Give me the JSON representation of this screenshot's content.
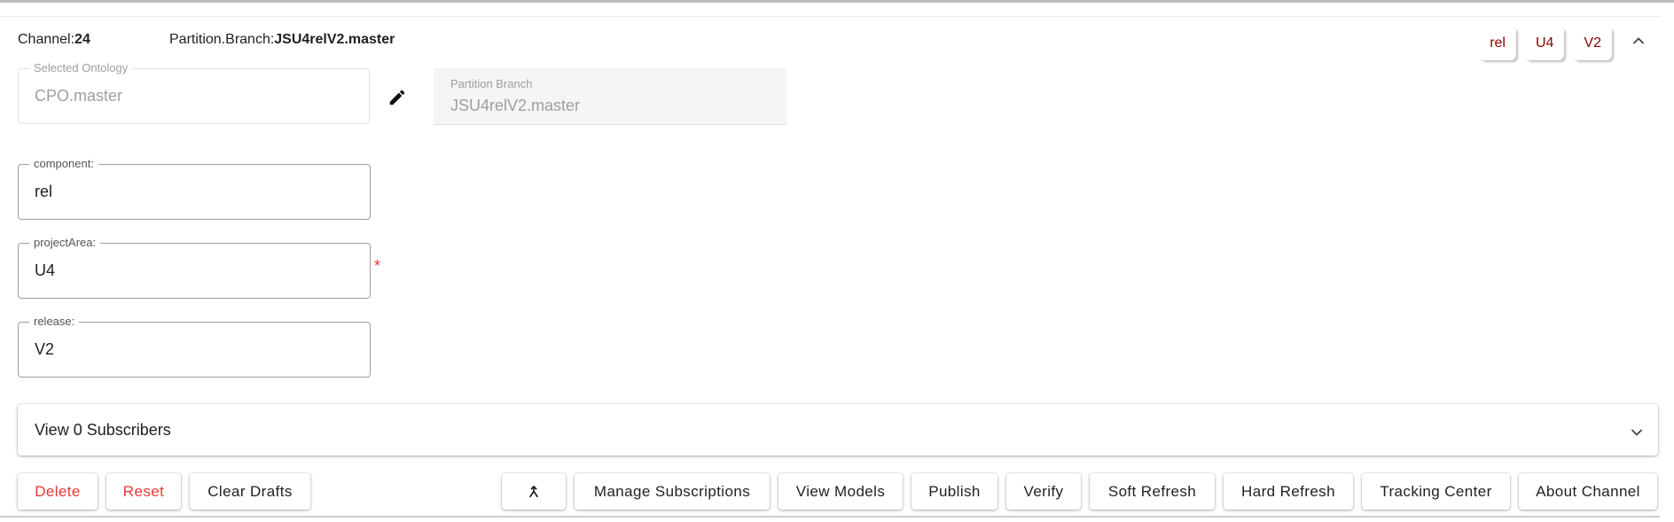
{
  "header": {
    "channel_label": "Channel:",
    "channel_value": "24",
    "partition_label": "Partition.Branch:",
    "partition_value": "JSU4relV2.master"
  },
  "chips": [
    "rel",
    "U4",
    "V2"
  ],
  "ontology": {
    "legend": "Selected Ontology",
    "value": "CPO.master"
  },
  "partition_branch": {
    "label": "Partition Branch",
    "value": "JSU4relV2.master"
  },
  "fields": {
    "component": {
      "legend": "component:",
      "value": "rel"
    },
    "projectArea": {
      "legend": "projectArea:",
      "value": "U4",
      "required": "*"
    },
    "release": {
      "legend": "release:",
      "value": "V2"
    }
  },
  "subscribers": {
    "title": "View 0 Subscribers"
  },
  "buttons": {
    "delete": "Delete",
    "reset": "Reset",
    "clear_drafts": "Clear Drafts",
    "manage_subscriptions": "Manage Subscriptions",
    "view_models": "View Models",
    "publish": "Publish",
    "verify": "Verify",
    "soft_refresh": "Soft Refresh",
    "hard_refresh": "Hard Refresh",
    "tracking_center": "Tracking Center",
    "about_channel": "About Channel"
  },
  "colors": {
    "chip_text": "#8b0000",
    "danger": "#e53935",
    "disabled_text": "#9e9e9e"
  },
  "icons": {
    "edit": "pencil-icon",
    "expand": "chevron-up-icon",
    "collapse": "chevron-down-icon",
    "merge": "merge-icon"
  }
}
